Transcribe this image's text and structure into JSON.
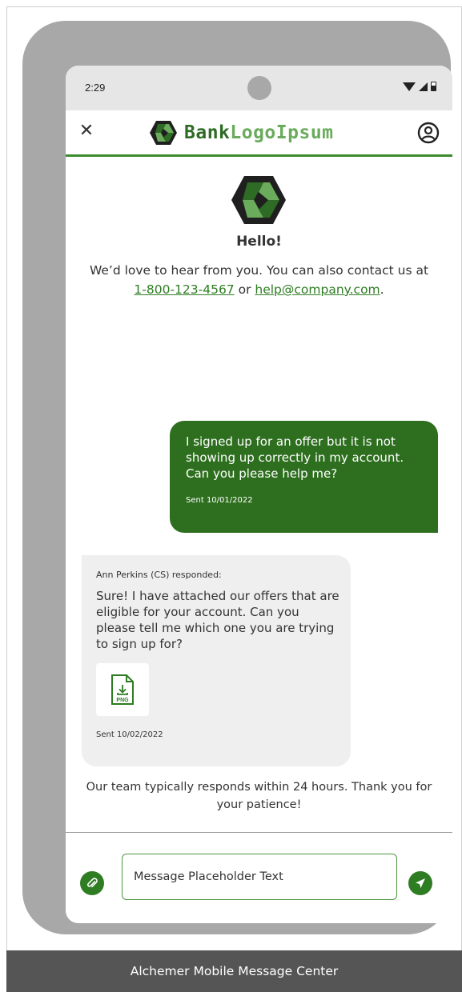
{
  "status_bar": {
    "time": "2:29"
  },
  "header": {
    "brand_bank": "Bank",
    "brand_rest": "LogoIpsum",
    "close_icon": "close-icon",
    "profile_icon": "user-circle-icon"
  },
  "intro": {
    "hello": "Hello!",
    "text_before": "We’d love to hear from you. You can also contact us at ",
    "phone": "1-800-123-4567",
    "text_between": " or ",
    "email": "help@company.com",
    "text_after": "."
  },
  "messages": [
    {
      "direction": "outgoing",
      "text": "I signed up for an offer but it is not showing up correctly in my account. Can you please help me?",
      "sent": "Sent 10/01/2022"
    },
    {
      "direction": "incoming",
      "author": "Ann Perkins (CS) responded:",
      "text": "Sure! I have attached our offers that are eligible for your account. Can you please tell me which one you are trying to sign up for?",
      "attachment_label": "PNG",
      "sent": "Sent 10/02/2022"
    }
  ],
  "footer_note": "Our team typically responds within 24 hours. Thank you for your patience!",
  "composer": {
    "placeholder": "Message Placeholder Text",
    "attach_icon": "paperclip-icon",
    "send_icon": "send-icon"
  },
  "caption": "Alchemer Mobile Message Center",
  "colors": {
    "brand_dark": "#2e6b24",
    "brand_light": "#6aab5c",
    "bubble_out": "#2e6f1f",
    "bubble_in": "#efefef",
    "accent": "#2e7d22"
  }
}
